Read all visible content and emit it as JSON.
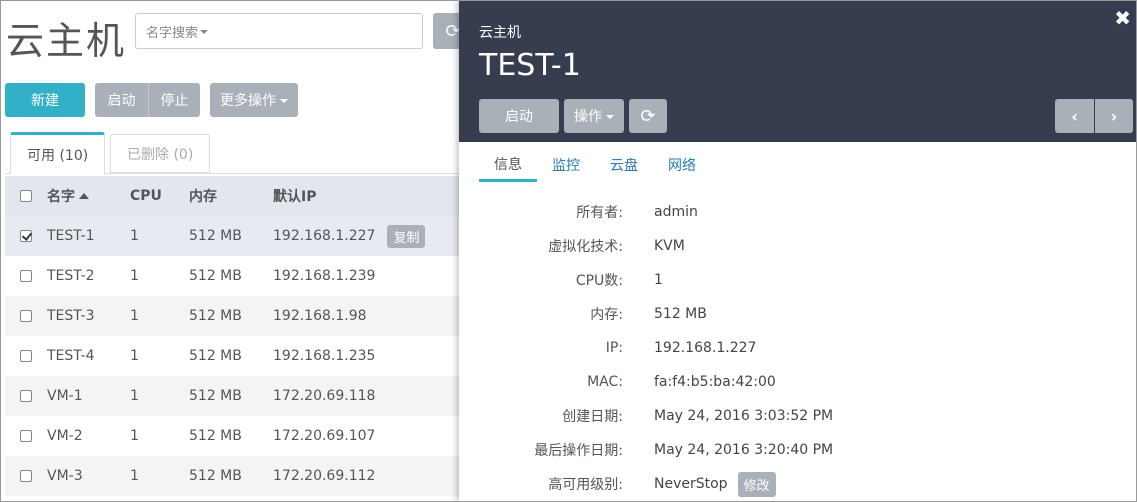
{
  "page": {
    "title": "云主机"
  },
  "search": {
    "placeholder": "名字搜索"
  },
  "toolbar": {
    "new_label": "新建",
    "start_label": "启动",
    "stop_label": "停止",
    "more_label": "更多操作"
  },
  "tabs": [
    {
      "label": "可用 (10)"
    },
    {
      "label": "已删除 (0)"
    }
  ],
  "table": {
    "columns": [
      "名字",
      "CPU",
      "内存",
      "默认IP"
    ],
    "copy_label": "复制",
    "rows": [
      {
        "name": "TEST-1",
        "cpu": "1",
        "mem": "512 MB",
        "ip": "192.168.1.227",
        "checked": true
      },
      {
        "name": "TEST-2",
        "cpu": "1",
        "mem": "512 MB",
        "ip": "192.168.1.239",
        "checked": false
      },
      {
        "name": "TEST-3",
        "cpu": "1",
        "mem": "512 MB",
        "ip": "192.168.1.98",
        "checked": false
      },
      {
        "name": "TEST-4",
        "cpu": "1",
        "mem": "512 MB",
        "ip": "192.168.1.235",
        "checked": false
      },
      {
        "name": "VM-1",
        "cpu": "1",
        "mem": "512 MB",
        "ip": "172.20.69.118",
        "checked": false
      },
      {
        "name": "VM-2",
        "cpu": "1",
        "mem": "512 MB",
        "ip": "172.20.69.107",
        "checked": false
      },
      {
        "name": "VM-3",
        "cpu": "1",
        "mem": "512 MB",
        "ip": "172.20.69.112",
        "checked": false
      }
    ]
  },
  "detail": {
    "label": "云主机",
    "title": "TEST-1",
    "start_label": "启动",
    "ops_label": "操作",
    "tabs": [
      "信息",
      "监控",
      "云盘",
      "网络"
    ],
    "edit_label": "修改",
    "props": [
      {
        "k": "所有者:",
        "v": "admin"
      },
      {
        "k": "虚拟化技术:",
        "v": "KVM"
      },
      {
        "k": "CPU数:",
        "v": "1"
      },
      {
        "k": "内存:",
        "v": "512 MB"
      },
      {
        "k": "IP:",
        "v": "192.168.1.227"
      },
      {
        "k": "MAC:",
        "v": "fa:f4:b5:ba:42:00"
      },
      {
        "k": "创建日期:",
        "v": "May 24, 2016 3:03:52 PM"
      },
      {
        "k": "最后操作日期:",
        "v": "May 24, 2016 3:20:40 PM"
      },
      {
        "k": "高可用级别:",
        "v": "NeverStop"
      }
    ]
  }
}
